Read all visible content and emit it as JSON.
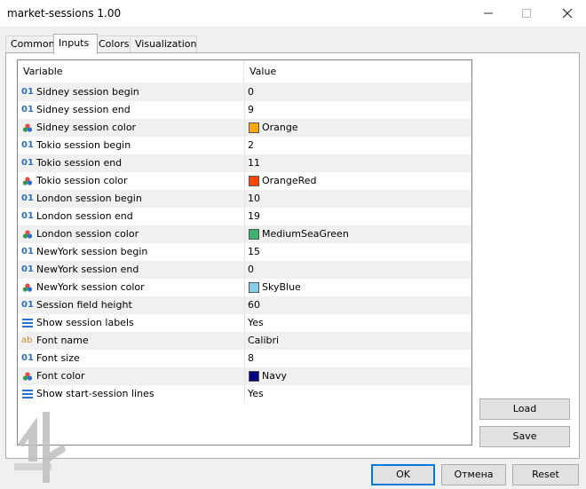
{
  "window": {
    "title": "market-sessions 1.00"
  },
  "tabs": [
    "Common",
    "Inputs",
    "Colors",
    "Visualization"
  ],
  "grid": {
    "headers": {
      "variable": "Variable",
      "value": "Value"
    },
    "rows": [
      {
        "icon": "num",
        "label": "Sidney session begin",
        "value": "0"
      },
      {
        "icon": "num",
        "label": "Sidney session end",
        "value": "9"
      },
      {
        "icon": "color",
        "label": "Sidney session color",
        "value": "Orange",
        "swatch": "#ffa500"
      },
      {
        "icon": "num",
        "label": "Tokio session begin",
        "value": "2"
      },
      {
        "icon": "num",
        "label": "Tokio session end",
        "value": "11"
      },
      {
        "icon": "color",
        "label": "Tokio session color",
        "value": "OrangeRed",
        "swatch": "#ff4500"
      },
      {
        "icon": "num",
        "label": "London session begin",
        "value": "10"
      },
      {
        "icon": "num",
        "label": "London session end",
        "value": "19"
      },
      {
        "icon": "color",
        "label": "London session color",
        "value": "MediumSeaGreen",
        "swatch": "#3cb371"
      },
      {
        "icon": "num",
        "label": "NewYork session begin",
        "value": "15"
      },
      {
        "icon": "num",
        "label": "NewYork session end",
        "value": "0"
      },
      {
        "icon": "color",
        "label": "NewYork session color",
        "value": "SkyBlue",
        "swatch": "#87ceeb"
      },
      {
        "icon": "num",
        "label": "Session field height",
        "value": "60"
      },
      {
        "icon": "enum",
        "label": "Show session labels",
        "value": "Yes"
      },
      {
        "icon": "str",
        "label": "Font name",
        "value": "Calibri"
      },
      {
        "icon": "num",
        "label": "Font size",
        "value": "8"
      },
      {
        "icon": "color",
        "label": "Font color",
        "value": "Navy",
        "swatch": "#000080"
      },
      {
        "icon": "enum",
        "label": "Show start-session lines",
        "value": "Yes"
      }
    ]
  },
  "side_buttons": {
    "load": "Load",
    "save": "Save"
  },
  "footer_buttons": {
    "ok": "OK",
    "cancel": "Отмена",
    "reset": "Reset"
  }
}
